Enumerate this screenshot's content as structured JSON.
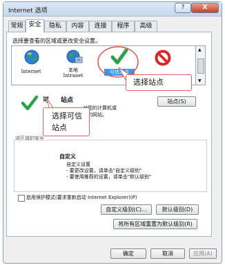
{
  "window": {
    "title": "Internet 选项",
    "help_glyph": "?",
    "close_glyph": "X"
  },
  "tabs": [
    "常规",
    "安全",
    "隐私",
    "内容",
    "连接",
    "程序",
    "高级"
  ],
  "security": {
    "zone_prompt": "选择要查看的区域或更改安全设置。",
    "zones": [
      {
        "label": "Internet",
        "icon": "globe-icon"
      },
      {
        "label": "本地\nIntranet",
        "icon": "intranet-icon"
      },
      {
        "label": "可信站点",
        "icon": "checkmark-icon",
        "selected": true
      },
      {
        "label": "受限站点",
        "icon": "restricted-icon"
      }
    ],
    "selected_zone_title_fragment": "可",
    "selected_zone_title_tail": "站点",
    "zone_desc_fragment": "对您的计算机或",
    "zone_desc_line2_fragment": "信的网站。",
    "sites_button": "站点(S)",
    "level_heading_fragment": "该区域的安全",
    "level_title": "自定义",
    "level_lines": [
      "自定义设置",
      "- 要更改设置，请单击\"自定义级别\"",
      "- 要使用推荐的设置，请单击\"默认级别\""
    ],
    "protected_mode_label": "启用保护模式(要求重新启动 Internet Explorer)(P)",
    "custom_level_button": "自定义级别(C)...",
    "default_level_button": "默认级别(D)",
    "reset_all_button": "将所有区域重置为默认级别(R)"
  },
  "callouts": {
    "select_site": "选择站点",
    "select_trusted_line1": "选择可信",
    "select_trusted_line2": "站点"
  },
  "footer": {
    "ok": "确定",
    "cancel": "取消",
    "apply": "应用(A)"
  },
  "colors": {
    "accent_red": "#e05050",
    "check_green": "#2aa24a",
    "selection_blue": "#3399ff"
  }
}
